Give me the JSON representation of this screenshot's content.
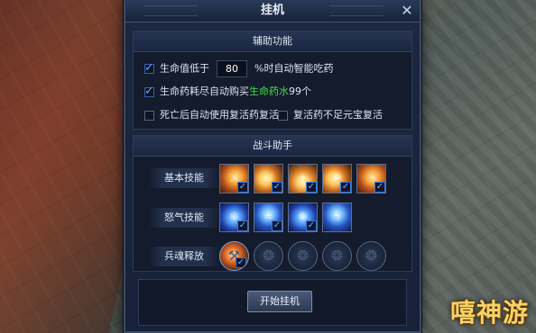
{
  "window": {
    "title": "挂机"
  },
  "assist": {
    "header": "辅助功能",
    "opt1_prefix": "生命值低于",
    "opt1_value": "80",
    "opt1_suffix": "%时自动智能吃药",
    "opt1_checked": true,
    "opt2_prefix": "生命药耗尽自动购买",
    "opt2_highlight": "生命药水",
    "opt2_suffix": "99个",
    "opt2_checked": true,
    "opt3_label": "死亡后自动使用复活药复活",
    "opt3_checked": false,
    "opt4_label": "复活药不足元宝复活",
    "opt4_checked": false
  },
  "combat": {
    "header": "战斗助手",
    "basic_label": "基本技能",
    "rage_label": "怒气技能",
    "soul_label": "兵魂释放",
    "basic_skills": [
      {
        "icon": "fire-slash-skill-icon",
        "checked": true
      },
      {
        "icon": "fire-sweep-skill-icon",
        "checked": true
      },
      {
        "icon": "flame-burst-skill-icon",
        "checked": true
      },
      {
        "icon": "fire-strike-skill-icon",
        "checked": true
      },
      {
        "icon": "blaze-skill-icon",
        "checked": true
      }
    ],
    "rage_skills": [
      {
        "icon": "ice-storm-skill-icon",
        "checked": true
      },
      {
        "icon": "frost-wave-skill-icon",
        "checked": true
      },
      {
        "icon": "ice-beast-skill-icon",
        "checked": true
      },
      {
        "icon": "lightning-skill-icon",
        "checked": false
      }
    ],
    "soul_slots": [
      {
        "icon": "hammer-soul-icon",
        "active": true,
        "checked": true
      },
      {
        "icon": "empty-soul-slot-icon",
        "active": false,
        "checked": false
      },
      {
        "icon": "empty-soul-slot-icon",
        "active": false,
        "checked": false
      },
      {
        "icon": "empty-soul-slot-icon",
        "active": false,
        "checked": false
      },
      {
        "icon": "empty-soul-slot-icon",
        "active": false,
        "checked": false
      }
    ]
  },
  "actions": {
    "start_label": "开始挂机"
  },
  "watermark": "嘻神游"
}
